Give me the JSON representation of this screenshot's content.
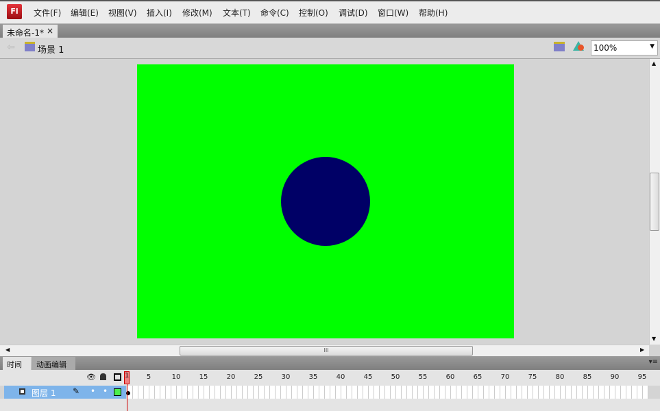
{
  "app": {
    "logo": "Fl"
  },
  "menu": [
    "文件(F)",
    "编辑(E)",
    "视图(V)",
    "插入(I)",
    "修改(M)",
    "文本(T)",
    "命令(C)",
    "控制(O)",
    "调试(D)",
    "窗口(W)",
    "帮助(H)"
  ],
  "document_tab": {
    "title": "未命名-1*",
    "close": "×"
  },
  "scene": {
    "label": "场景 1",
    "zoom": "100%"
  },
  "stage": {
    "background": "#00ff00",
    "circle_color": "#000066"
  },
  "hscroll_grip": "III",
  "timeline": {
    "tabs": [
      "时间轴",
      "动画编辑器"
    ],
    "layer_name": "图层 1",
    "current_frame": "1",
    "frame_labels": [
      "5",
      "10",
      "15",
      "20",
      "25",
      "30",
      "35",
      "40",
      "45",
      "50",
      "55",
      "60",
      "65",
      "70",
      "75",
      "80",
      "85",
      "90",
      "95"
    ]
  }
}
